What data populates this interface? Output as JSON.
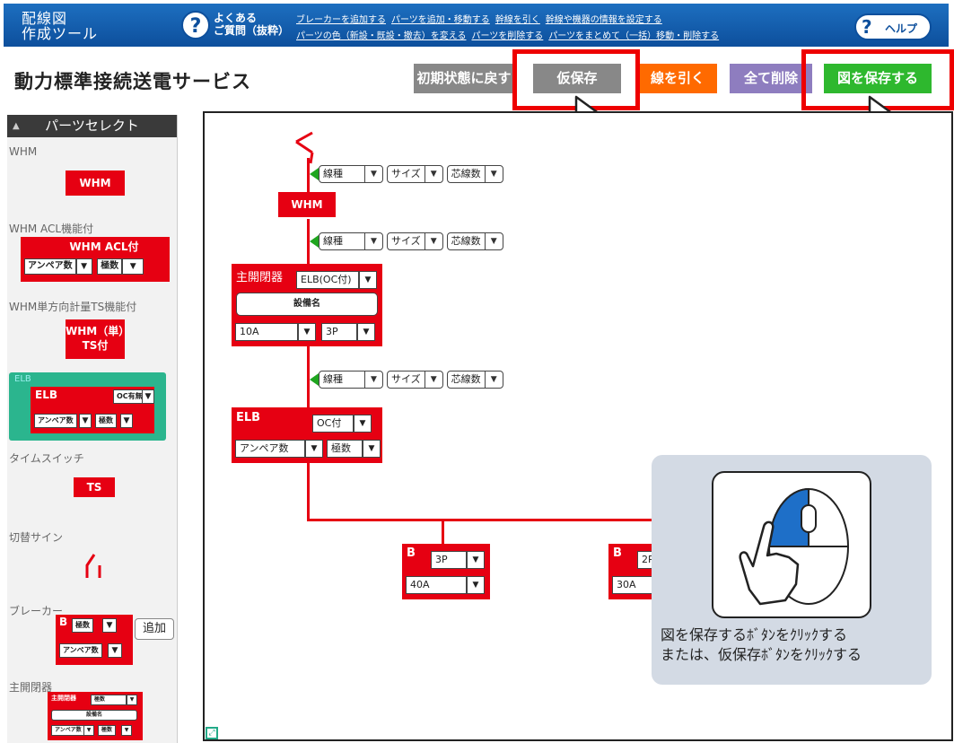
{
  "header": {
    "app_title_1": "配線図",
    "app_title_2": "作成ツール",
    "faq_1": "よくある",
    "faq_2": "ご質問（抜粋）",
    "links_row1": [
      "ブレーカーを追加する",
      "パーツを追加・移動する",
      "幹線を引く",
      "幹線や機器の情報を設定する"
    ],
    "links_row2": [
      "パーツの色（新設・既設・撤去）を変える",
      "パーツを削除する",
      "パーツをまとめて（一括）移動・削除する"
    ],
    "help_label": "ヘルプ",
    "help_mark": "?"
  },
  "toolbar": {
    "service_title": "動力標準接続送電サービス",
    "reset": "初期状態に戻す",
    "temp_save": "仮保存",
    "draw_line": "線を引く",
    "clear_all": "全て削除",
    "save": "図を保存する",
    "asterisk": "※"
  },
  "sidebar": {
    "header": "パーツセレクト",
    "whm_label": "WHM",
    "whm_part": "WHM",
    "whm_acl_label": "WHM ACL機能付",
    "whm_acl_part": "WHM  ACL付",
    "amp": "アンペア数",
    "poles": "極数",
    "whm_ts_label": "WHM単方向計量TS機能付",
    "whm_ts_part_1": "WHM（単）",
    "whm_ts_part_2": "TS付",
    "elb_label": "ELB",
    "elb_part": "ELB",
    "elb_oc": "OC有無",
    "timer_label": "タイムスイッチ",
    "ts_part": "TS",
    "switch_label": "切替サイン",
    "breaker_label": "ブレーカー",
    "breaker_part": "B",
    "add_button": "追加",
    "main_switch_label": "主開閉器",
    "main_switch_part": "主開閉器",
    "equipment_name": "設備名"
  },
  "canvas": {
    "cable_type": "線種",
    "size": "サイズ",
    "cores": "芯線数",
    "whm": "WHM",
    "main_switch": "主開閉器",
    "main_switch_type": "ELB(OC付)",
    "equipment_name": "設備名",
    "main_amp": "10A",
    "main_poles": "3P",
    "elb": "ELB",
    "elb_oc": "OC付",
    "elb_amp": "アンペア数",
    "elb_poles": "極数",
    "b1": "B",
    "b1_poles": "3P",
    "b1_amp": "40A",
    "b2": "B",
    "b2_poles": "2P",
    "b2_amp": "30A"
  },
  "popup": {
    "line1": "図を保存するﾎﾞﾀﾝをｸﾘｯｸする",
    "line2": "または、仮保存ﾎﾞﾀﾝをｸﾘｯｸする"
  }
}
